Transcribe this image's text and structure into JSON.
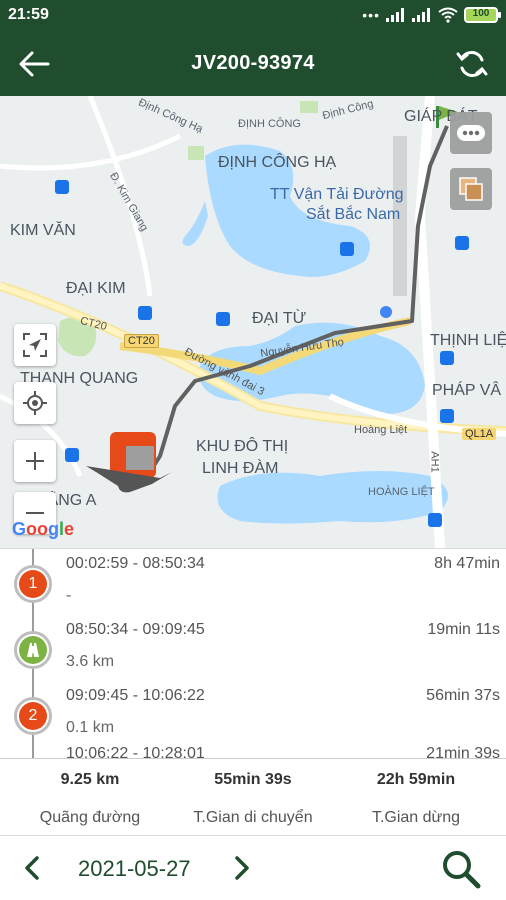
{
  "status_bar": {
    "time": "21:59",
    "battery": "100"
  },
  "app_bar": {
    "title": "JV200-93974"
  },
  "map": {
    "labels": {
      "giap_bat": "GIÁP BÁT",
      "dinh_cong": "ĐỊNH CÔNG",
      "dinh_cong_street": "Định Công",
      "dinh_cong_ha_street": "Định Công Hạ",
      "dinh_cong_ha": "ĐỊNH CÔNG HẠ",
      "tt_van_tai": "TT Vận Tải Đường",
      "sat_bac_nam": "Sắt Bắc Nam",
      "kim_van": "KIM VĂN",
      "kim_giang": "Đ. Kim Giang",
      "dai_kim": "ĐẠI KIM",
      "dai_tu": "ĐẠI TỪ",
      "ct20": "CT20",
      "ct20_badge": "CT20",
      "nguyen_huu_tho": "Nguyễn Hữu Thọ",
      "thanh_quang": "THANH QUANG",
      "duong_vanh_dai": "Đường vành đai 3",
      "thinh_liet": "THỊNH LIỆ",
      "phap_van": "PHÁP VÂ",
      "hoang_liet_road": "Hoàng Liệt",
      "hoang_liet": "HOÀNG LIỆT",
      "khu_do_thi": "KHU ĐÔ THỊ",
      "linh_dam": "LINH ĐÀM",
      "hang_a": "HẰNG A",
      "ql1a": "QL1A",
      "ah1": "AH1"
    },
    "google": {
      "g": "G",
      "oo": "oo",
      "g2": "g",
      "l": "l",
      "e": "e"
    }
  },
  "timeline": [
    {
      "index": "1",
      "type": "stop",
      "time": "00:02:59 - 08:50:34",
      "duration": "8h 47min",
      "distance": "-"
    },
    {
      "index": "",
      "type": "move",
      "time": "08:50:34 - 09:09:45",
      "duration": "19min 11s",
      "distance": "3.6 km"
    },
    {
      "index": "2",
      "type": "stop",
      "time": "09:09:45 - 10:06:22",
      "duration": "56min 37s",
      "distance": "0.1 km"
    },
    {
      "index": "",
      "type": "move",
      "time": "10:06:22 - 10:28:01",
      "duration": "21min 39s",
      "distance": ""
    }
  ],
  "summary": {
    "distance": {
      "value": "9.25 km",
      "label": "Quãng đường"
    },
    "moving": {
      "value": "55min 39s",
      "label": "T.Gian di chuyển"
    },
    "stopped": {
      "value": "22h 59min",
      "label": "T.Gian dừng"
    }
  },
  "date": "2021-05-27",
  "colors": {
    "primary": "#1f4d2d",
    "stop": "#e64a19",
    "move": "#7cb342",
    "route": "#616161"
  }
}
